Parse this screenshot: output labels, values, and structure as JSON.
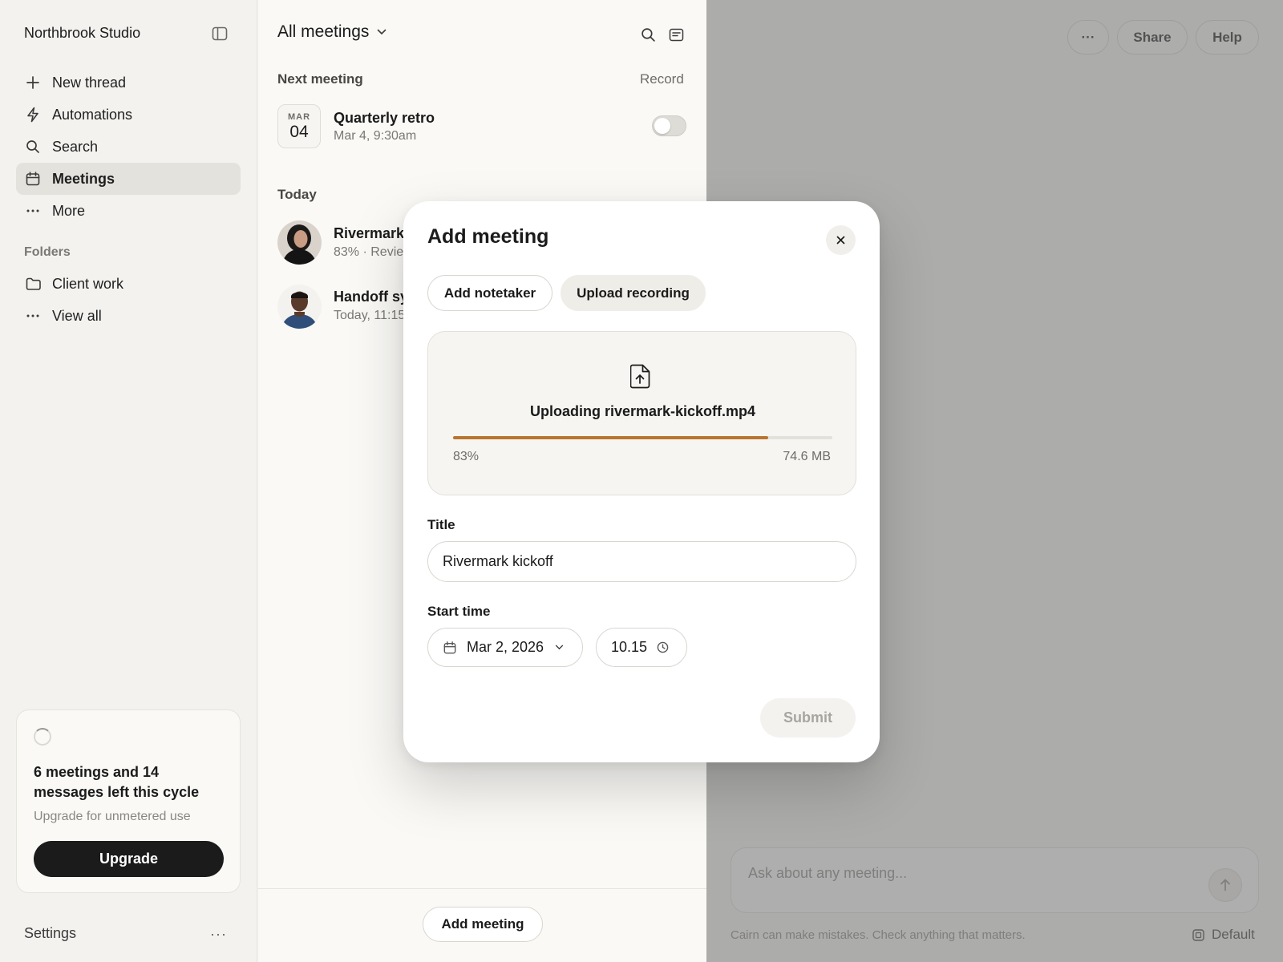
{
  "sidebar": {
    "workspace_name": "Northbrook Studio",
    "nav": [
      {
        "label": "New thread",
        "icon": "plus-icon"
      },
      {
        "label": "Automations",
        "icon": "bolt-icon"
      },
      {
        "label": "Search",
        "icon": "search-icon"
      },
      {
        "label": "Meetings",
        "icon": "calendar-icon",
        "active": true
      },
      {
        "label": "More",
        "icon": "more-dots-icon"
      }
    ],
    "folders_label": "Folders",
    "folders": [
      {
        "label": "Client work",
        "icon": "folder-icon"
      },
      {
        "label": "View all",
        "icon": "more-dots-icon"
      }
    ],
    "usage": {
      "title": "6 meetings and 14 messages left this cycle",
      "subtitle": "Upgrade for unmetered use",
      "button": "Upgrade"
    },
    "settings_label": "Settings",
    "settings_more": "···"
  },
  "meetings": {
    "header": "All meetings",
    "next_label": "Next meeting",
    "record_label": "Record",
    "next_meeting": {
      "month": "MAR",
      "day": "04",
      "title": "Quarterly retro",
      "time": "Mar 4, 9:30am",
      "record_on": false
    },
    "today_label": "Today",
    "today": [
      {
        "title": "Rivermark",
        "subtitle": "83% · Revie"
      },
      {
        "title": "Handoff sy",
        "subtitle": "Today, 11:15"
      }
    ],
    "add_button": "Add meeting"
  },
  "chat": {
    "more_label": "···",
    "share_label": "Share",
    "help_label": "Help",
    "input_placeholder": "Ask about any meeting...",
    "disclaimer": "Cairn can make mistakes. Check anything that matters.",
    "model_label": "Default"
  },
  "modal": {
    "title": "Add meeting",
    "tabs": [
      "Add notetaker",
      "Upload recording"
    ],
    "active_tab": "Upload recording",
    "upload": {
      "label": "Uploading rivermark-kickoff.mp4",
      "progress": 0.83,
      "progress_label": "83%",
      "size": "74.6 MB"
    },
    "title_label": "Title",
    "title_value": "Rivermark kickoff",
    "start_label": "Start time",
    "date_value": "Mar 2, 2026",
    "time_value": "10.15",
    "submit_label": "Submit",
    "submit_enabled": false
  },
  "colors": {
    "accent_progress": "#b9752f",
    "primary_button": "#1b1b1b",
    "background": "#f3f2ef"
  }
}
